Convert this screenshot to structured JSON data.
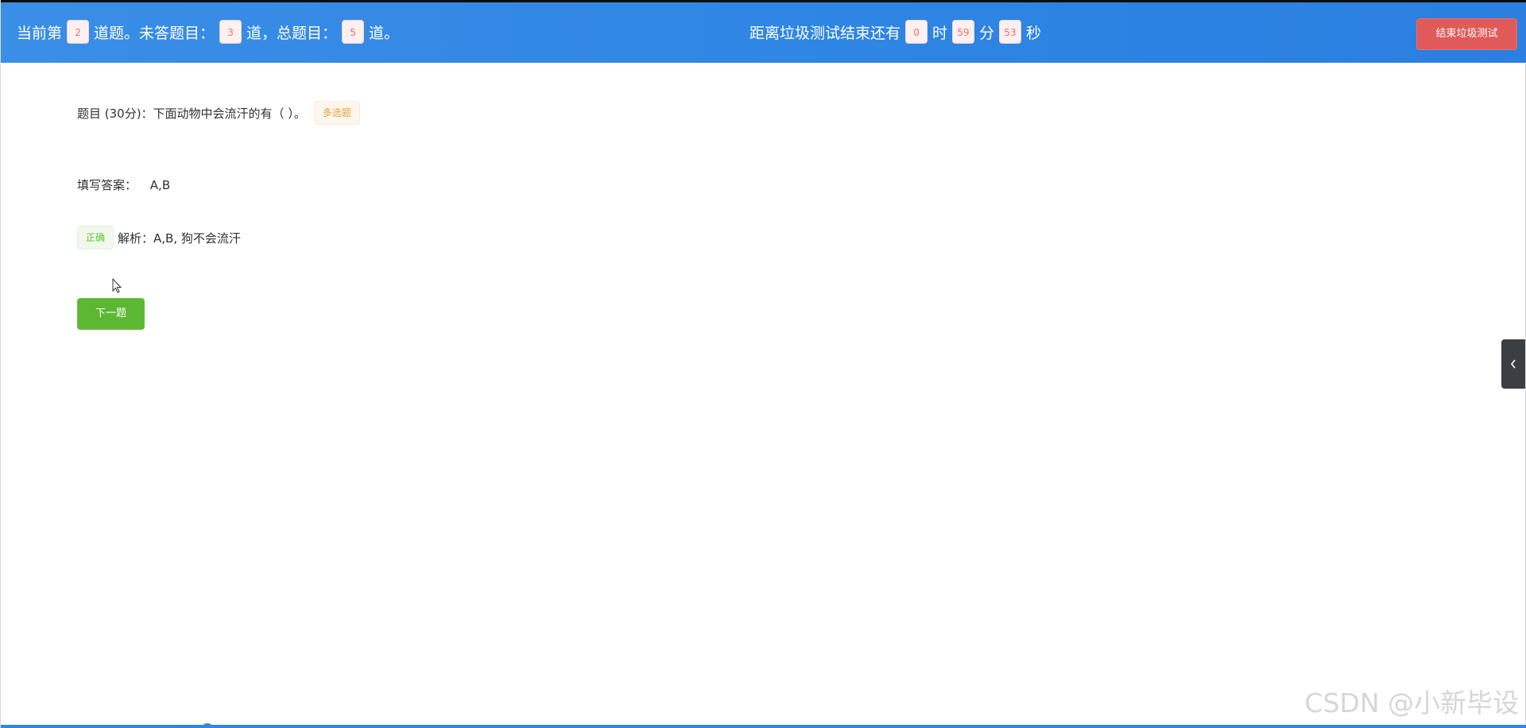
{
  "header": {
    "current_prefix": "当前第",
    "current_number": "2",
    "current_suffix": "道题。未答题目：",
    "unanswered_count": "3",
    "unanswered_suffix": "道，总题目：",
    "total_count": "5",
    "total_suffix": "道。",
    "timer_prefix": "距离垃圾测试结束还有",
    "hours": "0",
    "hours_unit": "时",
    "minutes": "59",
    "minutes_unit": "分",
    "seconds": "53",
    "seconds_unit": "秒",
    "end_button_label": "结束垃圾测试"
  },
  "question": {
    "text": "题目 (30分)：下面动物中会流汗的有（ ）。",
    "type_tag": "多选题"
  },
  "answer": {
    "label": "填写答案：",
    "value": "A,B"
  },
  "analysis": {
    "result_tag": "正确",
    "text": "解析：A,B, 狗不会流汗"
  },
  "actions": {
    "next_label": "下一题"
  },
  "side_panel": {
    "toggle_icon": "chevron-left-icon"
  },
  "watermark": {
    "text": "CSDN @小新毕设"
  },
  "colors": {
    "header_blue": "#2f86e4",
    "danger_red": "#e05a5a",
    "success_green": "#5cb832",
    "warning_orange": "#e6a23c",
    "count_red": "#f56c6c"
  }
}
